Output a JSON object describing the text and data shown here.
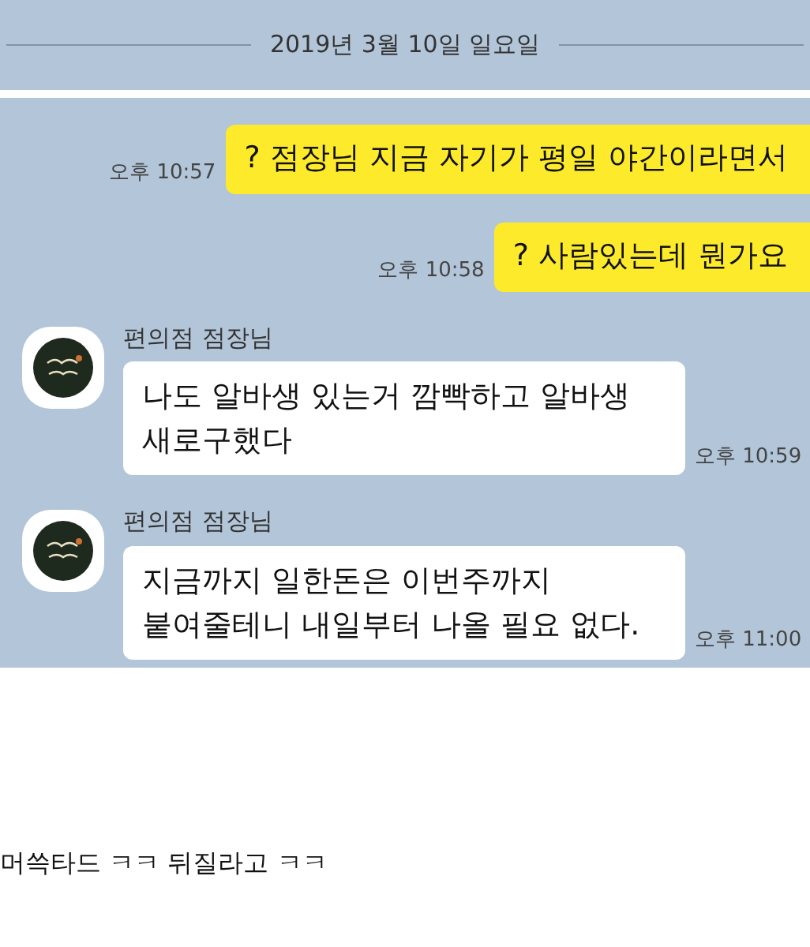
{
  "date_divider": "2019년 3월 10일 일요일",
  "messages": [
    {
      "kind": "sent",
      "text": "? 점장님 지금 자기가 평일 야간이라면서",
      "time": "오후 10:57"
    },
    {
      "kind": "sent",
      "text": "? 사람있는데 뭔가요",
      "time": "오후 10:58"
    },
    {
      "kind": "received",
      "sender": "편의점 점장님",
      "lines": [
        "나도 알바생 있는거 깜빡하고 알바생",
        "새로구했다"
      ],
      "time": "오후 10:59"
    },
    {
      "kind": "received",
      "sender": "편의점 점장님",
      "lines": [
        "지금까지 일한돈은 이번주까지",
        "붙여줄테니 내일부터 나올 필요 없다."
      ],
      "time": "오후 11:00"
    }
  ],
  "caption": "머쓱타드 ㅋㅋ 뒤질라고 ㅋㅋ"
}
